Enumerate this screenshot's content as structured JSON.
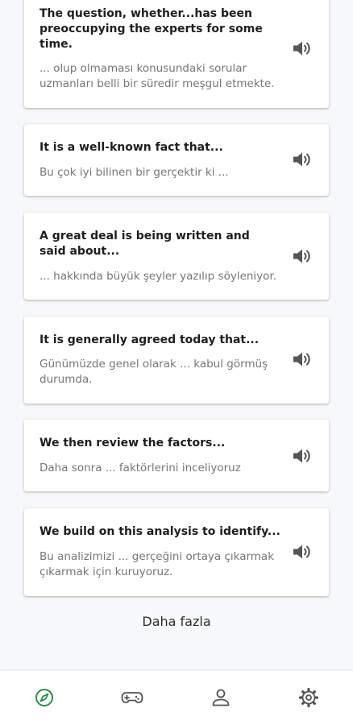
{
  "phrases": [
    {
      "english": "The question, whether...has been preoccupying the experts for some time.",
      "turkish": "... olup olmaması konusundaki sorular uzmanları belli bir süredir meşgul etmekte."
    },
    {
      "english": "It is a well-known fact that...",
      "turkish": "Bu çok iyi bilinen bir gerçektir ki ..."
    },
    {
      "english": "A great deal is being written and said about...",
      "turkish": "... hakkında büyük şeyler yazılıp söyleniyor."
    },
    {
      "english": "It is generally agreed today that...",
      "turkish": "Günümüzde genel olarak ... kabul görmüş durumda."
    },
    {
      "english": "We then review the factors...",
      "turkish": "Daha sonra ... faktörlerini inceliyoruz"
    },
    {
      "english": "We build on this analysis to identify...",
      "turkish": "Bu analizimizi ... gerçeğini ortaya çıkarmak çıkarmak için kuruyoruz."
    }
  ],
  "more_label": "Daha fazla",
  "speaker_icon": "speaker-icon",
  "nav": [
    {
      "icon": "compass-icon",
      "active": true
    },
    {
      "icon": "gamepad-icon",
      "active": false
    },
    {
      "icon": "person-icon",
      "active": false
    },
    {
      "icon": "gear-icon",
      "active": false
    }
  ],
  "colors": {
    "background": "#f7f8f9",
    "card": "#ffffff",
    "title_text": "#1e1e1e",
    "subtitle_text": "#767676",
    "icon": "#555555",
    "accent": "#2e8b47"
  }
}
